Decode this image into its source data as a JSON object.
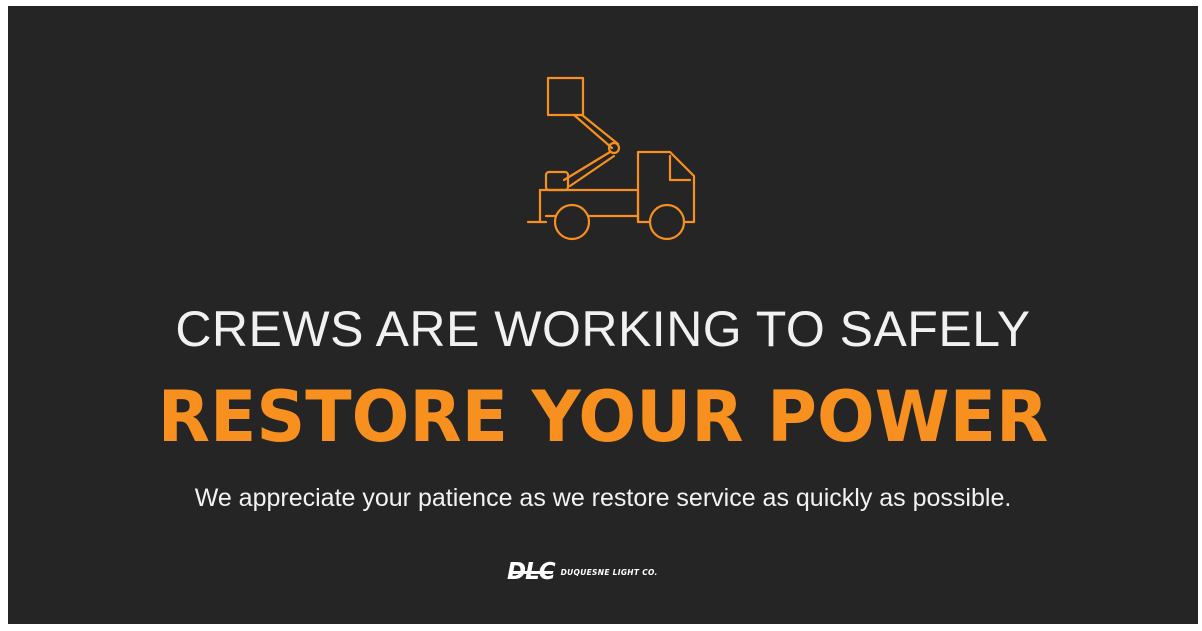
{
  "banner": {
    "icon": "bucket-truck-icon",
    "headline_line1": "CREWS ARE WORKING TO SAFELY",
    "headline_line2": "RESTORE YOUR POWER",
    "message": "We appreciate your patience as we restore service as quickly as possible.",
    "logo_mark": "DLC",
    "logo_name": "DUQUESNE LIGHT CO."
  },
  "colors": {
    "background": "#252525",
    "accent": "#f7901e",
    "text": "#f1f1f1"
  }
}
